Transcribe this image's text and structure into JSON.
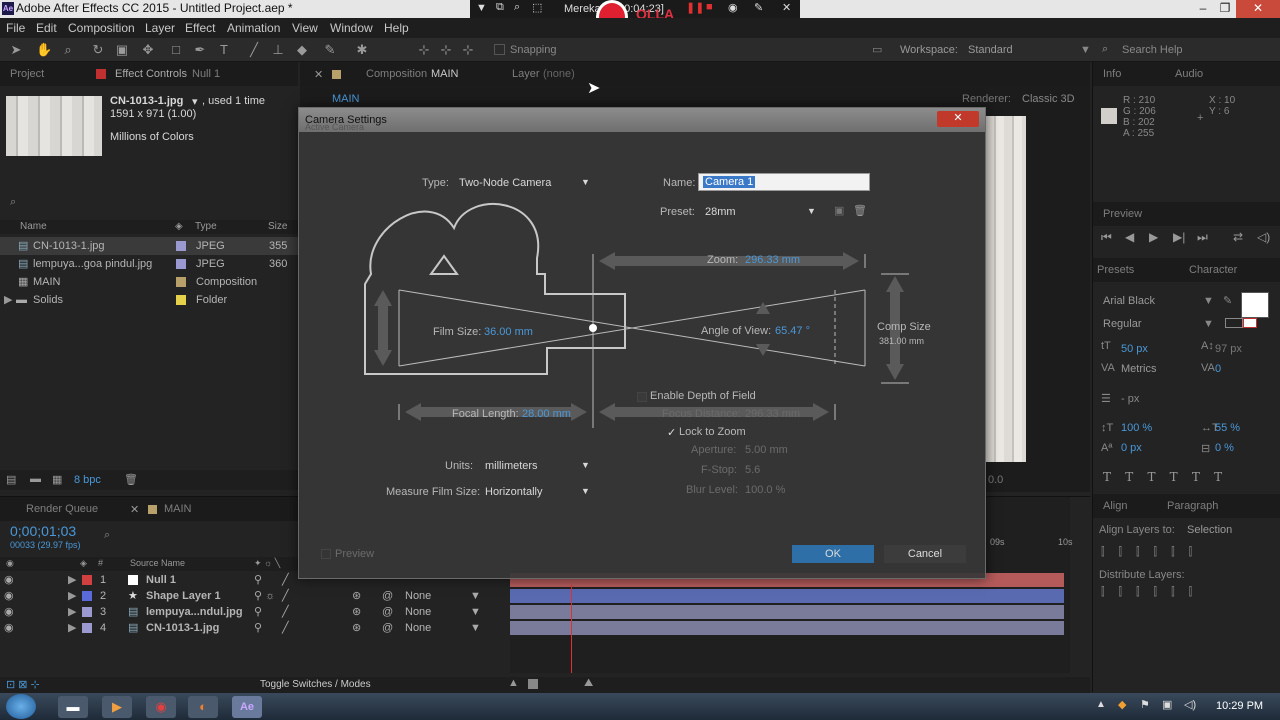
{
  "window": {
    "title": "Adobe After Effects CC 2015 - Untitled Project.aep *",
    "app_icon": "Ae"
  },
  "recorder": {
    "label": "Mereka",
    "time": "00:04:23]",
    "logo": "OLLA"
  },
  "menu": [
    "File",
    "Edit",
    "Composition",
    "Layer",
    "Effect",
    "Animation",
    "View",
    "Window",
    "Help"
  ],
  "toolbar": {
    "snapping": "Snapping",
    "workspace_label": "Workspace:",
    "workspace_value": "Standard",
    "search_placeholder": "Search Help"
  },
  "project_panel": {
    "tab_project": "Project",
    "tab_effect": "Effect Controls",
    "tab_effect_target": "Null 1",
    "thumb_name": "CN-1013-1.jpg",
    "thumb_used": ", used 1 time",
    "thumb_dims": "1591 x 971 (1.00)",
    "thumb_colors": "Millions of Colors",
    "col_name": "Name",
    "col_type": "Type",
    "col_size": "Size",
    "items": [
      {
        "name": "CN-1013-1.jpg",
        "type": "JPEG",
        "size": "355",
        "color": "#9a9ad0"
      },
      {
        "name": "lempuya...goa pindul.jpg",
        "type": "JPEG",
        "size": "360",
        "color": "#9a9ad0"
      },
      {
        "name": "MAIN",
        "type": "Composition",
        "size": "",
        "color": "#b8a06a"
      },
      {
        "name": "Solids",
        "type": "Folder",
        "size": "",
        "color": "#e6d24a"
      }
    ],
    "bpc": "8 bpc"
  },
  "comp_panel": {
    "tab_comp": "Composition",
    "tab_comp_name": "MAIN",
    "tab_layer": "Layer",
    "tab_layer_val": "(none)",
    "breadcrumb": "MAIN",
    "renderer_label": "Renderer:",
    "renderer_value": "Classic 3D",
    "zoom_tail": "0.0"
  },
  "dialog": {
    "title": "Camera Settings",
    "ghost_title": "Active Camera",
    "type_label": "Type:",
    "type_value": "Two-Node Camera",
    "name_label": "Name:",
    "name_value": "Camera 1",
    "preset_label": "Preset:",
    "preset_value": "28mm",
    "zoom_label": "Zoom:",
    "zoom_value": "296.33 mm",
    "film_label": "Film Size:",
    "film_value": "36.00 mm",
    "aov_label": "Angle of View:",
    "aov_value": "65.47 °",
    "comp_label": "Comp Size",
    "comp_value": "381.00 mm",
    "dof_label": "Enable Depth of Field",
    "focal_label": "Focal Length:",
    "focal_value": "28.00 mm",
    "focus_label": "Focus Distance:",
    "focus_value": "296.33 mm",
    "lock_label": "Lock to Zoom",
    "aperture_label": "Aperture:",
    "aperture_value": "5.00 mm",
    "fstop_label": "F-Stop:",
    "fstop_value": "5.6",
    "blur_label": "Blur Level:",
    "blur_value": "100.0 %",
    "units_label": "Units:",
    "units_value": "millimeters",
    "measure_label": "Measure Film Size:",
    "measure_value": "Horizontally",
    "preview_label": "Preview",
    "ok_label": "OK",
    "cancel_label": "Cancel"
  },
  "timeline": {
    "tab_render": "Render Queue",
    "tab_main": "MAIN",
    "timecode": "0;00;01;03",
    "fps": "00033 (29.97 fps)",
    "col_source": "Source Name",
    "col_parent": "None",
    "ruler_9s": "09s",
    "ruler_10s": "10s",
    "layers": [
      {
        "num": "1",
        "name": "Null 1",
        "color": "#d04040",
        "parent": "None"
      },
      {
        "num": "2",
        "name": "Shape Layer 1",
        "color": "#5a6ad8",
        "parent": "None"
      },
      {
        "num": "3",
        "name": "lempuya...ndul.jpg",
        "color": "#9a9ad0",
        "parent": "None"
      },
      {
        "num": "4",
        "name": "CN-1013-1.jpg",
        "color": "#9a9ad0",
        "parent": "None"
      }
    ],
    "toggle_label": "Toggle Switches / Modes"
  },
  "info_panel": {
    "tab_info": "Info",
    "tab_audio": "Audio",
    "r": "R : 210",
    "g": "G : 206",
    "b": "B : 202",
    "a": "A : 255",
    "x": "X : 10",
    "y": "Y : 6"
  },
  "preview_panel": {
    "tab": "Preview"
  },
  "character_panel": {
    "tab_presets": "Presets",
    "tab_character": "Character",
    "font": "Arial Black",
    "style": "Regular",
    "size": "50 px",
    "leading": "97 px",
    "kerning": "Metrics",
    "tracking": "0",
    "stroke": "- px",
    "vscale": "100 %",
    "hscale": "55 %",
    "baseline": "0 px",
    "tsume": "0 %"
  },
  "align_panel": {
    "tab_align": "Align",
    "tab_paragraph": "Paragraph",
    "align_to_label": "Align Layers to:",
    "align_to_value": "Selection",
    "distribute": "Distribute Layers:"
  },
  "taskbar": {
    "time": "10:29 PM"
  }
}
